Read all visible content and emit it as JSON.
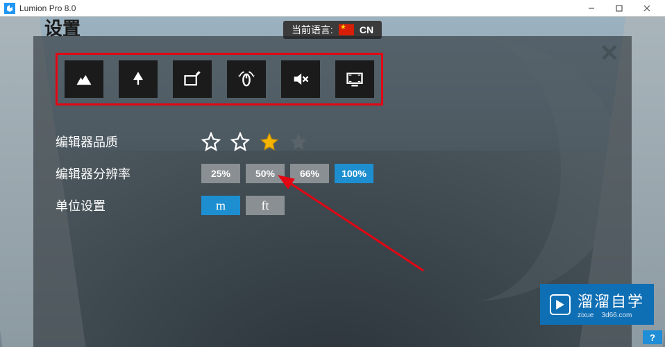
{
  "window": {
    "title": "Lumion Pro 8.0",
    "min_label": "minimize",
    "max_label": "maximize",
    "close_label": "close"
  },
  "header": {
    "title": "设置"
  },
  "language": {
    "prefix": "当前语言:",
    "code": "CN"
  },
  "panel": {
    "close_label": "✕"
  },
  "tabs": [
    {
      "id": "landscape",
      "icon": "mountain"
    },
    {
      "id": "nature",
      "icon": "tree"
    },
    {
      "id": "tablet",
      "icon": "tablet-pen"
    },
    {
      "id": "navigation",
      "icon": "mouse-rotate"
    },
    {
      "id": "audio",
      "icon": "mute"
    },
    {
      "id": "display",
      "icon": "monitor"
    }
  ],
  "quality": {
    "label": "编辑器品质",
    "stars": [
      "empty",
      "empty",
      "filled",
      "disabled"
    ]
  },
  "resolution": {
    "label": "编辑器分辨率",
    "options": [
      {
        "label": "25%",
        "active": false
      },
      {
        "label": "50%",
        "active": false
      },
      {
        "label": "66%",
        "active": false
      },
      {
        "label": "100%",
        "active": true
      }
    ]
  },
  "units": {
    "label": "单位设置",
    "options": [
      {
        "label": "m",
        "active": true
      },
      {
        "label": "ft",
        "active": false
      }
    ]
  },
  "watermark": {
    "brand": "溜溜自学",
    "sub_left": "zixue",
    "sub_right": "3d66.com"
  },
  "help": {
    "label": "?"
  }
}
